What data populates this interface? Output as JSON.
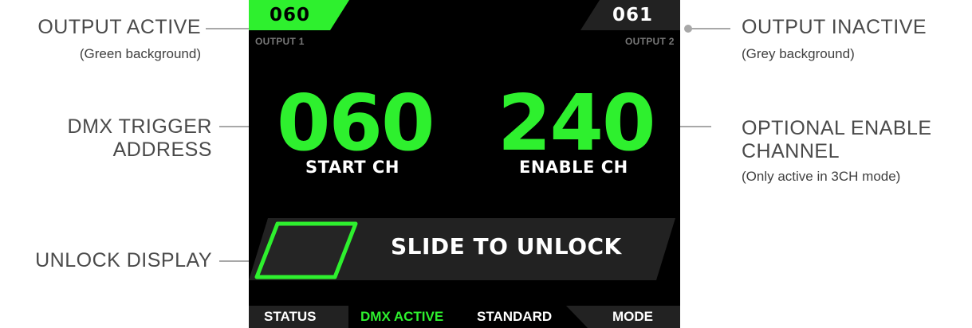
{
  "callouts": {
    "output_active": {
      "title": "OUTPUT ACTIVE",
      "note": "(Green background)"
    },
    "output_inactive": {
      "title": "OUTPUT INACTIVE",
      "note": "(Grey background)"
    },
    "dmx_trigger": {
      "line1": "DMX TRIGGER",
      "line2": "ADDRESS"
    },
    "optional_enable": {
      "line1": "OPTIONAL ENABLE",
      "line2": "CHANNEL",
      "note": "(Only active in 3CH mode)"
    },
    "unlock_display": {
      "title": "UNLOCK DISPLAY"
    }
  },
  "screen": {
    "output1": {
      "number": "060",
      "label": "OUTPUT 1",
      "state": "active"
    },
    "output2": {
      "number": "061",
      "label": "OUTPUT 2",
      "state": "inactive"
    },
    "start": {
      "value": "060",
      "label": "START CH"
    },
    "enable": {
      "value": "240",
      "label": "ENABLE CH"
    },
    "slider": {
      "label": "SLIDE TO UNLOCK"
    },
    "bottom": {
      "status": "STATUS",
      "dmx": "DMX ACTIVE",
      "standard": "STANDARD",
      "mode": "MODE"
    }
  },
  "colors": {
    "active_green": "#2ef02e",
    "inactive_grey": "#222222",
    "screen_bg": "#000000",
    "callout_line": "#a8a8a8"
  }
}
